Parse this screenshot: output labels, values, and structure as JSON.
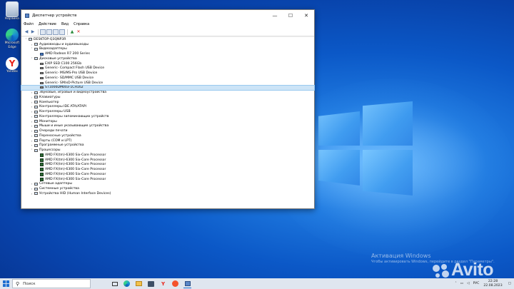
{
  "desktop": {
    "icons": [
      {
        "label": "Корзина",
        "icon": "recycle-bin-icon"
      },
      {
        "label": "Microsoft Edge",
        "icon": "edge-icon"
      },
      {
        "label": "Yandex",
        "icon": "yandex-icon"
      }
    ],
    "activation": {
      "title": "Активация Windows",
      "subtitle": "Чтобы активировать Windows, перейдите в раздел \"Параметры\"."
    },
    "watermark": "Avito"
  },
  "window": {
    "title": "Диспетчер устройств",
    "menu": [
      "Файл",
      "Действие",
      "Вид",
      "Справка"
    ],
    "controls": {
      "minimize": "—",
      "maximize": "☐",
      "close": "✕"
    },
    "tree": [
      {
        "label": "DESKTOP-Q3QNP3R",
        "level": 0,
        "exp": "˅",
        "icon": "computer"
      },
      {
        "label": "Аудиовходы и аудиовыходы",
        "level": 1,
        "exp": "›",
        "icon": "cat"
      },
      {
        "label": "Видеоадаптеры",
        "level": 1,
        "exp": "˅",
        "icon": "cat"
      },
      {
        "label": "AMD Radeon R7 200 Series",
        "level": 2,
        "exp": "",
        "icon": "gpu"
      },
      {
        "label": "Дисковые устройства",
        "level": 1,
        "exp": "˅",
        "icon": "cat"
      },
      {
        "label": "EXIP SSD C100 256Gb",
        "level": 2,
        "exp": "",
        "icon": "disk"
      },
      {
        "label": "Generic- Compact Flash USB Device",
        "level": 2,
        "exp": "",
        "icon": "disk"
      },
      {
        "label": "Generic- MS/MS-Pro USB Device",
        "level": 2,
        "exp": "",
        "icon": "disk"
      },
      {
        "label": "Generic- SD/MMC USB Device",
        "level": 2,
        "exp": "",
        "icon": "disk"
      },
      {
        "label": "Generic- SM/xD-Picture USB Device",
        "level": 2,
        "exp": "",
        "icon": "disk"
      },
      {
        "label": "ST1000DM003-1CH162",
        "level": 2,
        "exp": "",
        "icon": "disk",
        "selected": true
      },
      {
        "label": "Звуковые, игровые и видеоустройства",
        "level": 1,
        "exp": "›",
        "icon": "cat"
      },
      {
        "label": "Клавиатуры",
        "level": 1,
        "exp": "›",
        "icon": "cat"
      },
      {
        "label": "Компьютер",
        "level": 1,
        "exp": "›",
        "icon": "cat"
      },
      {
        "label": "Контроллеры IDE ATA/ATAPI",
        "level": 1,
        "exp": "›",
        "icon": "cat"
      },
      {
        "label": "Контроллеры USB",
        "level": 1,
        "exp": "›",
        "icon": "cat"
      },
      {
        "label": "Контроллеры запоминающих устройств",
        "level": 1,
        "exp": "›",
        "icon": "cat"
      },
      {
        "label": "Мониторы",
        "level": 1,
        "exp": "›",
        "icon": "cat"
      },
      {
        "label": "Мыши и иные указывающие устройства",
        "level": 1,
        "exp": "›",
        "icon": "cat"
      },
      {
        "label": "Очереди печати",
        "level": 1,
        "exp": "›",
        "icon": "cat"
      },
      {
        "label": "Переносные устройства",
        "level": 1,
        "exp": "›",
        "icon": "cat"
      },
      {
        "label": "Порты (COM и LPT)",
        "level": 1,
        "exp": "›",
        "icon": "cat"
      },
      {
        "label": "Программные устройства",
        "level": 1,
        "exp": "›",
        "icon": "cat"
      },
      {
        "label": "Процессоры",
        "level": 1,
        "exp": "˅",
        "icon": "cat"
      },
      {
        "label": "AMD FX(tm)-6300 Six-Core Processor",
        "level": 2,
        "exp": "",
        "icon": "cpu"
      },
      {
        "label": "AMD FX(tm)-6300 Six-Core Processor",
        "level": 2,
        "exp": "",
        "icon": "cpu"
      },
      {
        "label": "AMD FX(tm)-6300 Six-Core Processor",
        "level": 2,
        "exp": "",
        "icon": "cpu"
      },
      {
        "label": "AMD FX(tm)-6300 Six-Core Processor",
        "level": 2,
        "exp": "",
        "icon": "cpu"
      },
      {
        "label": "AMD FX(tm)-6300 Six-Core Processor",
        "level": 2,
        "exp": "",
        "icon": "cpu"
      },
      {
        "label": "AMD FX(tm)-6300 Six-Core Processor",
        "level": 2,
        "exp": "",
        "icon": "cpu"
      },
      {
        "label": "Сетевые адаптеры",
        "level": 1,
        "exp": "›",
        "icon": "cat"
      },
      {
        "label": "Системные устройства",
        "level": 1,
        "exp": "›",
        "icon": "cat"
      },
      {
        "label": "Устройства HID (Human Interface Devices)",
        "level": 1,
        "exp": "›",
        "icon": "cat"
      }
    ]
  },
  "taskbar": {
    "search_placeholder": "Поиск",
    "apps": [
      "task-view-icon",
      "edge-icon",
      "explorer-icon",
      "store-icon",
      "yandex-icon",
      "yandex-music-icon",
      "device-manager-icon"
    ],
    "tray": {
      "lang": "РУС",
      "time": "22:28",
      "date": "22.08.2023"
    }
  },
  "colors": {
    "selection": "#cce4f7",
    "taskbar": "#dfe6ef",
    "desktop": "#0b58c7"
  }
}
